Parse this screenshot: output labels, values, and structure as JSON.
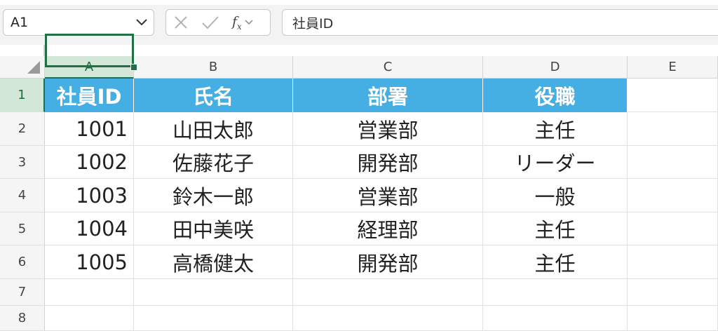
{
  "formula_bar": {
    "name_box": "A1",
    "fx_label": "f",
    "fx_sub": "x",
    "formula_value": "社員ID"
  },
  "columns": [
    "A",
    "B",
    "C",
    "D",
    "E"
  ],
  "rows": [
    "1",
    "2",
    "3",
    "4",
    "5",
    "6",
    "7",
    "8"
  ],
  "header": [
    "社員ID",
    "氏名",
    "部署",
    "役職"
  ],
  "records": [
    [
      "1001",
      "山田太郎",
      "営業部",
      "主任"
    ],
    [
      "1002",
      "佐藤花子",
      "開発部",
      "リーダー"
    ],
    [
      "1003",
      "鈴木一郎",
      "営業部",
      "一般"
    ],
    [
      "1004",
      "田中美咲",
      "経理部",
      "主任"
    ],
    [
      "1005",
      "高橋健太",
      "開発部",
      "主任"
    ]
  ],
  "colors": {
    "header_fill": "#45aee3",
    "selection": "#1e7145",
    "active_header": "#d3e7d8"
  }
}
